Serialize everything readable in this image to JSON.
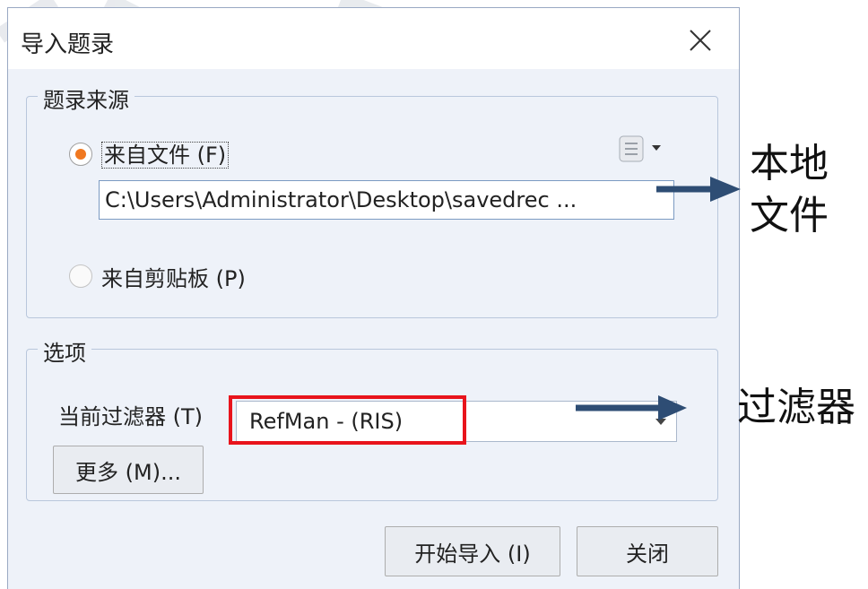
{
  "dialog": {
    "title": "导入题录",
    "source_group": {
      "legend": "题录来源",
      "from_file_label": "来自文件 (F)",
      "file_path": "C:\\Users\\Administrator\\Desktop\\savedrec ...",
      "from_clipboard_label": "来自剪贴板 (P)",
      "selected": "from_file"
    },
    "options_group": {
      "legend": "选项",
      "filter_label": "当前过滤器 (T)",
      "filter_value": "RefMan - (RIS)",
      "more_button": "更多 (M)..."
    },
    "buttons": {
      "start_import": "开始导入 (I)",
      "close": "关闭"
    }
  },
  "annotations": {
    "local_file_line1": "本地",
    "local_file_line2": "文件",
    "filter": "过滤器"
  },
  "colors": {
    "highlight": "#e8141c",
    "arrow": "#2e4d74",
    "radio_selected": "#f07820"
  }
}
